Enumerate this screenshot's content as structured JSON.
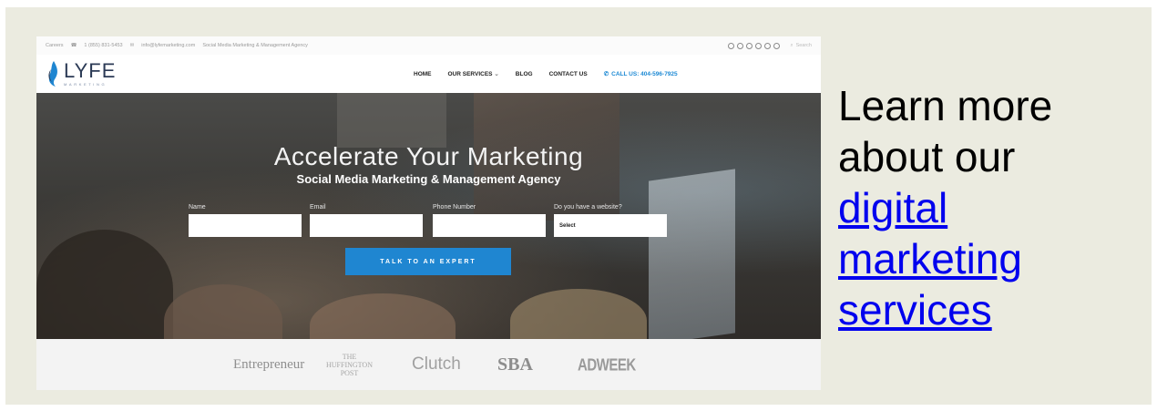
{
  "topbar": {
    "careers": "Careers",
    "phone": "1 (855) 831-5453",
    "email": "info@lyfemarketing.com",
    "tagline": "Social Media Marketing & Management Agency",
    "search_placeholder": "Search"
  },
  "header": {
    "logo_main": "LYFE",
    "logo_sub": "MARKETING",
    "nav": [
      "HOME",
      "OUR SERVICES",
      "BLOG",
      "CONTACT US"
    ],
    "services_chevron": "⌄",
    "call": "CALL US: 404-596-7925"
  },
  "hero": {
    "title": "Accelerate Your Marketing",
    "subtitle": "Social Media Marketing & Management Agency",
    "labels": [
      "Name",
      "Email",
      "Phone Number",
      "Do you have a website?"
    ],
    "select_value": "Select",
    "cta": "TALK TO AN EXPERT"
  },
  "press": {
    "entrepreneur": "Entrepreneur",
    "huffington": [
      "THE",
      "HUFFINGTON",
      "POST"
    ],
    "clutch": "Clutch",
    "sba": "SBA",
    "adweek": "ADWEEK"
  },
  "side": {
    "text_before": "Learn more about our",
    "link_text": "digital marketing services"
  },
  "colors": {
    "frame_bg": "#ebebe0",
    "brand_blue": "#1f86d1",
    "link": "#0000ee"
  }
}
